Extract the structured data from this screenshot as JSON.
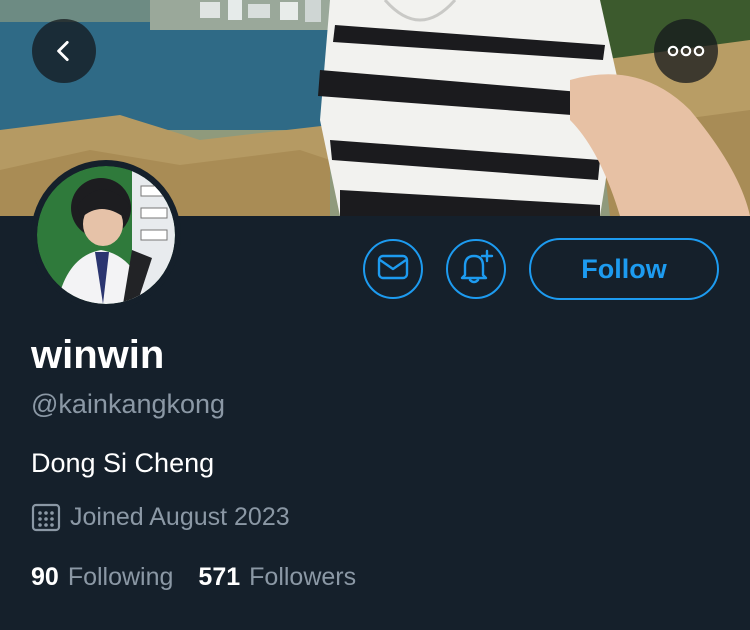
{
  "profile": {
    "display_name": "winwin",
    "handle": "@kainkangkong",
    "bio": "Dong Si Cheng",
    "joined": "Joined August 2023"
  },
  "actions": {
    "follow_label": "Follow"
  },
  "stats": {
    "following_count": "90",
    "following_label": "Following",
    "followers_count": "571",
    "followers_label": "Followers"
  },
  "icons": {
    "back": "chevron-left-icon",
    "more": "more-horizontal-icon",
    "message": "mail-icon",
    "notify": "bell-plus-icon",
    "calendar": "calendar-icon"
  },
  "colors": {
    "background": "#15202b",
    "accent": "#1d9bf0",
    "secondary_text": "#8b98a5",
    "primary_text": "#ffffff"
  }
}
